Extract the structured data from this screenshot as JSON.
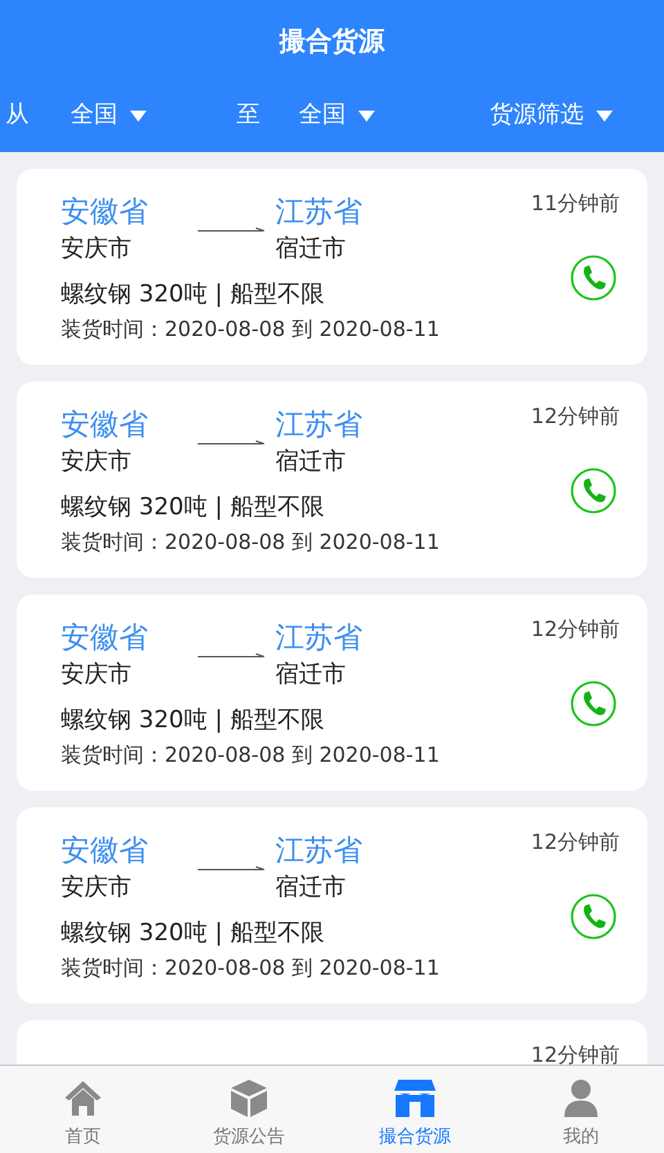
{
  "header": {
    "title": "撮合货源"
  },
  "filters": {
    "from_label": "从",
    "from_value": "全国",
    "to_label": "至",
    "to_value": "全国",
    "filter_label": "货源筛选"
  },
  "cards": [
    {
      "from_province": "安徽省",
      "from_city": "安庆市",
      "to_province": "江苏省",
      "to_city": "宿迁市",
      "time": "11分钟前",
      "cargo": "螺纹钢 320吨 | 船型不限",
      "loading": "装货时间：2020-08-08 到 2020-08-11"
    },
    {
      "from_province": "安徽省",
      "from_city": "安庆市",
      "to_province": "江苏省",
      "to_city": "宿迁市",
      "time": "12分钟前",
      "cargo": "螺纹钢 320吨 | 船型不限",
      "loading": "装货时间：2020-08-08 到 2020-08-11"
    },
    {
      "from_province": "安徽省",
      "from_city": "安庆市",
      "to_province": "江苏省",
      "to_city": "宿迁市",
      "time": "12分钟前",
      "cargo": "螺纹钢 320吨 | 船型不限",
      "loading": "装货时间：2020-08-08 到 2020-08-11"
    },
    {
      "from_province": "安徽省",
      "from_city": "安庆市",
      "to_province": "江苏省",
      "to_city": "宿迁市",
      "time": "12分钟前",
      "cargo": "螺纹钢 320吨 | 船型不限",
      "loading": "装货时间：2020-08-08 到 2020-08-11"
    },
    {
      "time": "12分钟前"
    }
  ],
  "tab_bar": [
    {
      "kind": "home",
      "label": "首页",
      "selected": false
    },
    {
      "kind": "box",
      "label": "货源公告",
      "selected": false
    },
    {
      "kind": "store",
      "label": "撮合货源",
      "selected": true
    },
    {
      "kind": "person",
      "label": "我的",
      "selected": false
    }
  ]
}
